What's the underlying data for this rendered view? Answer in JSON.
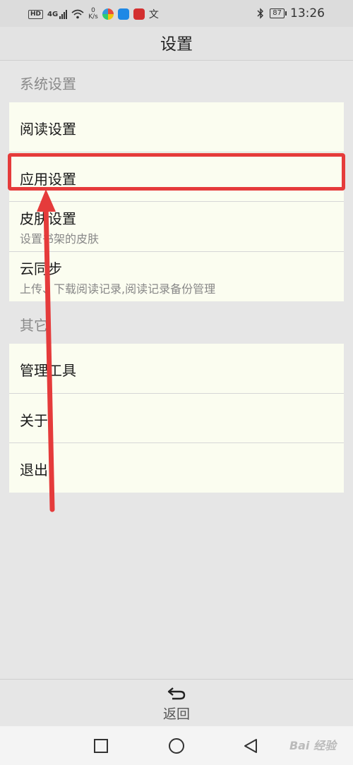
{
  "status_bar": {
    "network_badge": "HD",
    "network_type": "4G",
    "speed_value": "0",
    "speed_unit": "K/s",
    "app_icon_glyph": "文",
    "battery": "87",
    "time": "13:26"
  },
  "header": {
    "title": "设置"
  },
  "sections": [
    {
      "title": "系统设置",
      "items": [
        {
          "label": "阅读设置",
          "sub": ""
        },
        {
          "label": "应用设置",
          "sub": ""
        },
        {
          "label": "皮肤设置",
          "sub": "设置书架的皮肤"
        },
        {
          "label": "云同步",
          "sub": "上传、下载阅读记录,阅读记录备份管理"
        }
      ]
    },
    {
      "title": "其它",
      "items": [
        {
          "label": "管理工具",
          "sub": ""
        },
        {
          "label": "关于",
          "sub": ""
        },
        {
          "label": "退出",
          "sub": ""
        }
      ]
    }
  ],
  "footer": {
    "back_label": "返回"
  },
  "watermark": "Bai 经验",
  "colors": {
    "highlight": "#e53b3b",
    "card_bg": "#fbfdf0",
    "page_bg": "#e6e6e6"
  }
}
